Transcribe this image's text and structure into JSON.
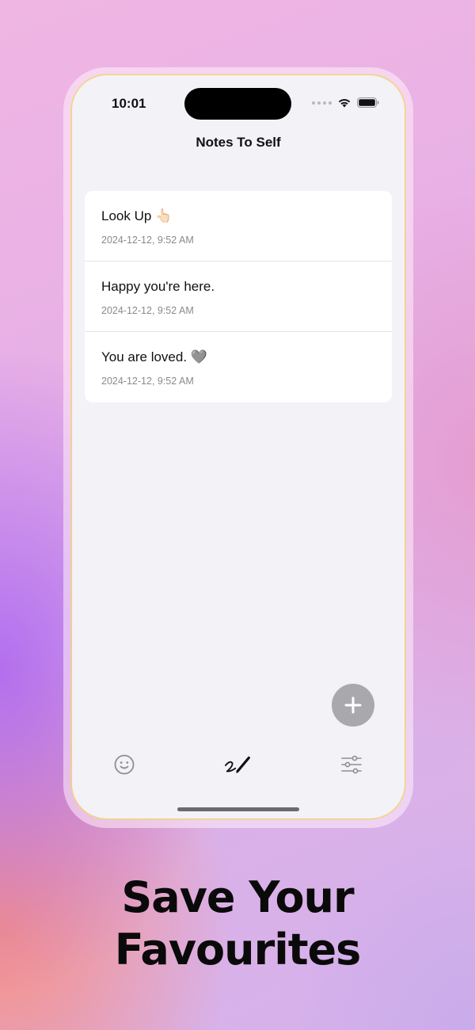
{
  "status_bar": {
    "time": "10:01"
  },
  "nav": {
    "title": "Notes To Self"
  },
  "notes": [
    {
      "title": "Look Up 👆🏻",
      "date": "2024-12-12, 9:52 AM"
    },
    {
      "title": "Happy you're here.",
      "date": "2024-12-12, 9:52 AM"
    },
    {
      "title": "You are loved. 🩶",
      "date": "2024-12-12, 9:52 AM"
    }
  ],
  "fab": {
    "icon": "plus-icon"
  },
  "tab_bar": {
    "items": [
      "smiley-icon",
      "pencil-scribble-icon",
      "sliders-icon"
    ]
  },
  "promo": {
    "line1": "Save Your",
    "line2": "Favourites"
  },
  "colors": {
    "frame_border": "#f4d27a",
    "screen_bg": "#f2f2f7",
    "fab_bg": "#a9a9ad"
  }
}
